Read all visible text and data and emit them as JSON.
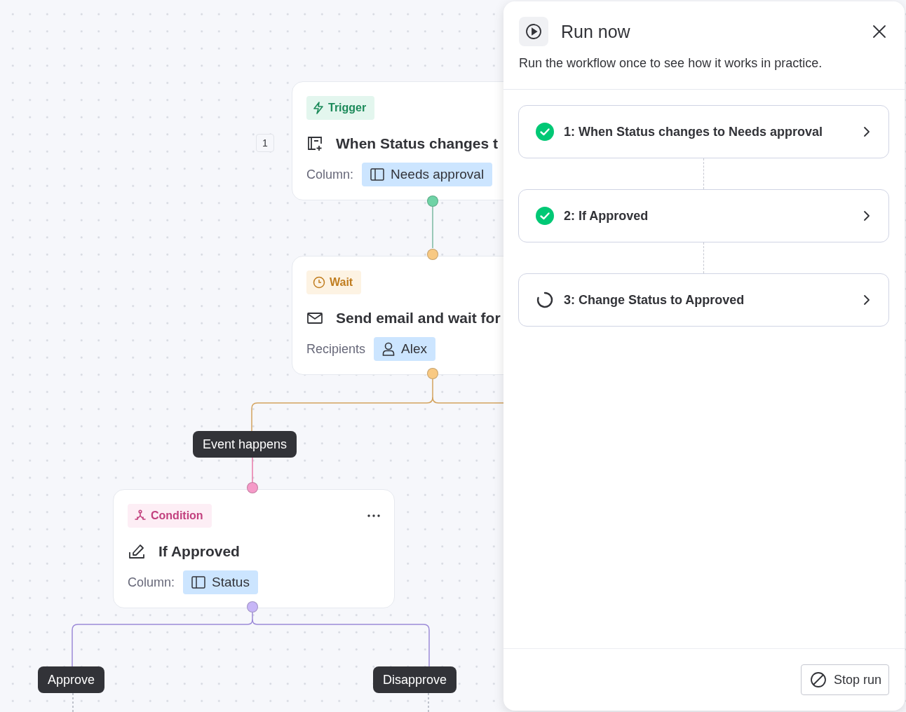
{
  "canvas": {
    "nodes": [
      {
        "kind": "trigger",
        "step_number": "1",
        "badge": "Trigger",
        "title": "When Status changes t",
        "field_label": "Column:",
        "chip": {
          "kind": "column",
          "label": "Needs approval"
        }
      },
      {
        "kind": "wait",
        "badge": "Wait",
        "title": "Send email and wait for",
        "field_label": "Recipients",
        "chip": {
          "kind": "person",
          "label": "Alex"
        }
      },
      {
        "kind": "condition",
        "badge": "Condition",
        "title": "If Approved",
        "field_label": "Column:",
        "chip": {
          "kind": "column",
          "label": "Status"
        },
        "menu": true
      }
    ],
    "edge_labels": [
      "Event happens",
      "Approve",
      "Disapprove"
    ]
  },
  "panel": {
    "title": "Run now",
    "subtitle": "Run the workflow once to see how it works in practice.",
    "steps": [
      {
        "label": "1: When Status changes to Needs approval",
        "kind": "done"
      },
      {
        "label": "2: If Approved",
        "kind": "done"
      },
      {
        "label": "3: Change Status to Approved",
        "kind": "running"
      }
    ],
    "stop_button": "Stop run"
  }
}
